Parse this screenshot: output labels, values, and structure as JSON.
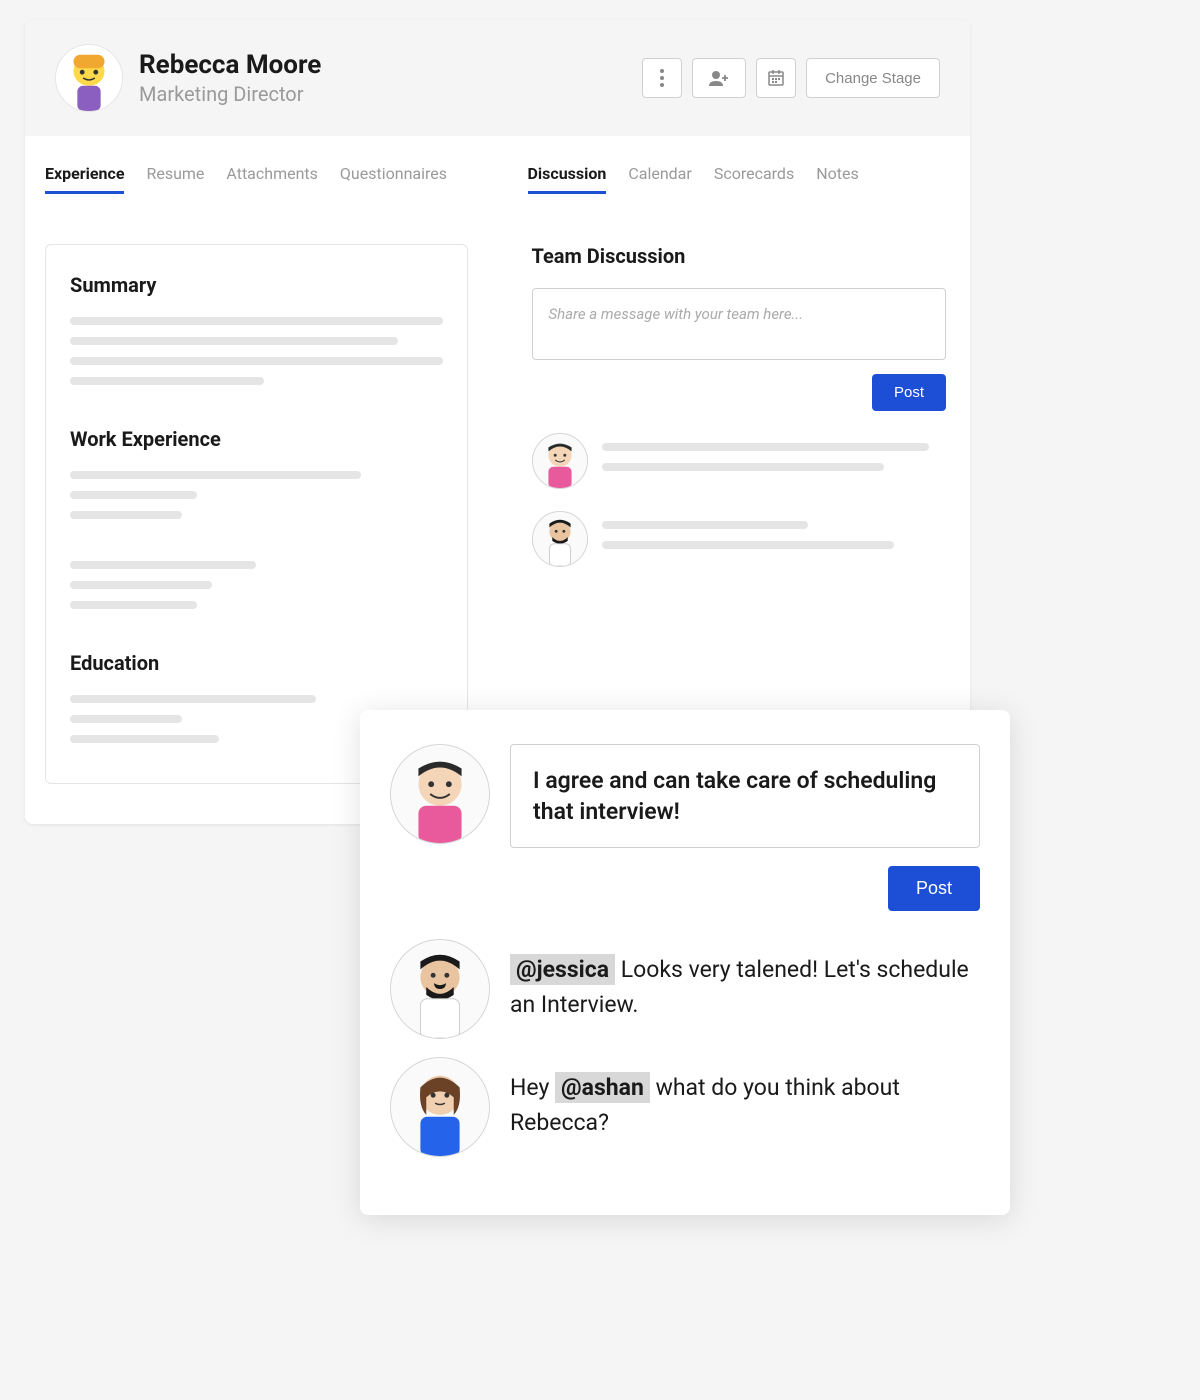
{
  "candidate": {
    "name": "Rebecca Moore",
    "title": "Marketing Director"
  },
  "actions": {
    "change_stage": "Change Stage"
  },
  "left_tabs": [
    "Experience",
    "Resume",
    "Attachments",
    "Questionnaires"
  ],
  "left_active": "Experience",
  "right_tabs": [
    "Discussion",
    "Calendar",
    "Scorecards",
    "Notes"
  ],
  "right_active": "Discussion",
  "sections": {
    "summary": "Summary",
    "work": "Work Experience",
    "education": "Education"
  },
  "discussion": {
    "title": "Team Discussion",
    "placeholder": "Share a message with your team here...",
    "post": "Post"
  },
  "overlay": {
    "compose": "I agree and can take care of scheduling that interview!",
    "post": "Post",
    "messages": [
      {
        "mention": "@jessica",
        "before": "",
        "after": " Looks very talened! Let's schedule an Interview."
      },
      {
        "mention": "@ashan",
        "before": "Hey ",
        "after": " what do you think about Rebecca?"
      }
    ]
  }
}
